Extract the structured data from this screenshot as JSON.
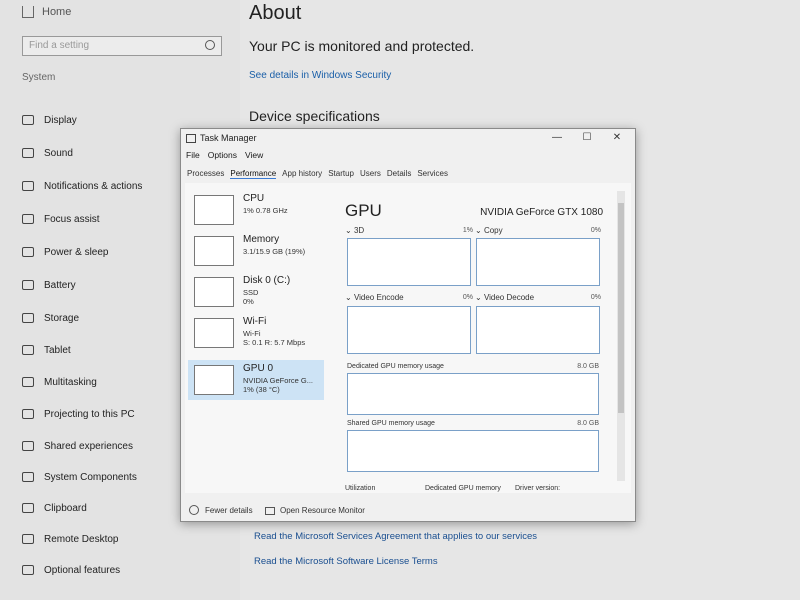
{
  "settings": {
    "home_label": "Home",
    "search_placeholder": "Find a setting",
    "section_label": "System",
    "nav_items": [
      {
        "label": "Display",
        "icon": "monitor-icon"
      },
      {
        "label": "Sound",
        "icon": "speaker-icon"
      },
      {
        "label": "Notifications & actions",
        "icon": "notification-icon"
      },
      {
        "label": "Focus assist",
        "icon": "moon-icon"
      },
      {
        "label": "Power & sleep",
        "icon": "power-icon"
      },
      {
        "label": "Battery",
        "icon": "battery-icon"
      },
      {
        "label": "Storage",
        "icon": "storage-icon"
      },
      {
        "label": "Tablet",
        "icon": "tablet-icon"
      },
      {
        "label": "Multitasking",
        "icon": "multitasking-icon"
      },
      {
        "label": "Projecting to this PC",
        "icon": "projecting-icon"
      },
      {
        "label": "Shared experiences",
        "icon": "shared-icon"
      },
      {
        "label": "System Components",
        "icon": "components-icon"
      },
      {
        "label": "Clipboard",
        "icon": "clipboard-icon"
      },
      {
        "label": "Remote Desktop",
        "icon": "remote-icon"
      },
      {
        "label": "Optional features",
        "icon": "features-icon"
      }
    ]
  },
  "about": {
    "title": "About",
    "protected_text": "Your PC is monitored and protected.",
    "security_link": "See details in Windows Security",
    "device_spec_heading": "Device specifications",
    "services_agreement_link": "Read the Microsoft Services Agreement that applies to our services",
    "license_terms_link": "Read the Microsoft Software License Terms"
  },
  "task_manager": {
    "title": "Task Manager",
    "window_controls": {
      "minimize": "—",
      "maximize": "☐",
      "close": "✕"
    },
    "menu": [
      "File",
      "Options",
      "View"
    ],
    "tabs": [
      "Processes",
      "Performance",
      "App history",
      "Startup",
      "Users",
      "Details",
      "Services"
    ],
    "active_tab": "Performance",
    "resources": [
      {
        "name": "CPU",
        "line1": "1% 0.78 GHz",
        "line2": ""
      },
      {
        "name": "Memory",
        "line1": "3.1/15.9 GB (19%)",
        "line2": ""
      },
      {
        "name": "Disk 0 (C:)",
        "line1": "SSD",
        "line2": "0%"
      },
      {
        "name": "Wi-Fi",
        "line1": "Wi-Fi",
        "line2": "S: 0.1 R: 5.7 Mbps"
      },
      {
        "name": "GPU 0",
        "line1": "NVIDIA GeForce G...",
        "line2": "1% (38 °C)"
      }
    ],
    "selected_resource": "GPU 0",
    "gpu_panel": {
      "heading": "GPU",
      "model": "NVIDIA GeForce GTX 1080",
      "engines": [
        {
          "label": "3D",
          "pct": "1%"
        },
        {
          "label": "Copy",
          "pct": "0%"
        },
        {
          "label": "Video Encode",
          "pct": "0%"
        },
        {
          "label": "Video Decode",
          "pct": "0%"
        }
      ],
      "dedicated_label": "Dedicated GPU memory usage",
      "dedicated_max": "8.0 GB",
      "shared_label": "Shared GPU memory usage",
      "shared_max": "8.0 GB",
      "stats_labels": [
        "Utilization",
        "Dedicated GPU memory",
        "Driver version:"
      ]
    },
    "footer": {
      "fewer_details": "Fewer details",
      "open_monitor": "Open Resource Monitor"
    },
    "accent_color": "#3a7bd5"
  }
}
